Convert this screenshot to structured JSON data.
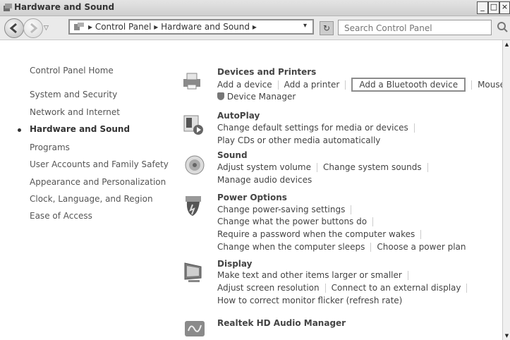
{
  "window": {
    "title": "Hardware and Sound",
    "buttons": {
      "minimize": "_",
      "maximize": "□",
      "close": "×"
    }
  },
  "address_bar": {
    "segments": [
      "▸ Control Panel",
      "▸ Hardware and Sound",
      "▸"
    ],
    "dropdown": "▾",
    "refresh_icon": "refresh-icon",
    "search_placeholder": "Search Control Panel"
  },
  "left_nav": {
    "items": [
      {
        "label": "Control Panel Home"
      },
      {
        "label": "System and Security"
      },
      {
        "label": "Network and Internet"
      },
      {
        "label": "Hardware and Sound",
        "current": true
      },
      {
        "label": "Programs"
      },
      {
        "label": "User Accounts and Family Safety"
      },
      {
        "label": "Appearance and Personalization"
      },
      {
        "label": "Clock, Language, and Region"
      },
      {
        "label": "Ease of Access"
      }
    ]
  },
  "categories": [
    {
      "title": "Devices and Printers",
      "icon": "printer-icon",
      "rows": [
        [
          "Add a device",
          "Add a printer",
          "Add a Bluetooth device",
          "Mouse"
        ],
        [
          "Device Manager"
        ]
      ]
    },
    {
      "title": "AutoPlay",
      "icon": "autoplay-icon",
      "rows": [
        [
          "Change default settings for media or devices"
        ],
        [
          "Play CDs or other media automatically"
        ]
      ]
    },
    {
      "title": "Sound",
      "icon": "speaker-icon",
      "rows": [
        [
          "Adjust system volume",
          "Change system sounds"
        ],
        [
          "Manage audio devices"
        ]
      ]
    },
    {
      "title": "Power Options",
      "icon": "power-icon",
      "rows": [
        [
          "Change power-saving settings"
        ],
        [
          "Change what the power buttons do"
        ],
        [
          "Require a password when the computer wakes"
        ],
        [
          "Change when the computer sleeps",
          "Choose a power plan"
        ]
      ]
    },
    {
      "title": "Display",
      "icon": "monitor-icon",
      "rows": [
        [
          "Make text and other items larger or smaller"
        ],
        [
          "Adjust screen resolution",
          "Connect to an external display"
        ],
        [
          "How to correct monitor flicker (refresh rate)"
        ]
      ]
    },
    {
      "title": "Realtek HD Audio Manager",
      "icon": "audio-manager-icon",
      "rows": []
    }
  ],
  "highlighted_link": "Add a Bluetooth device"
}
